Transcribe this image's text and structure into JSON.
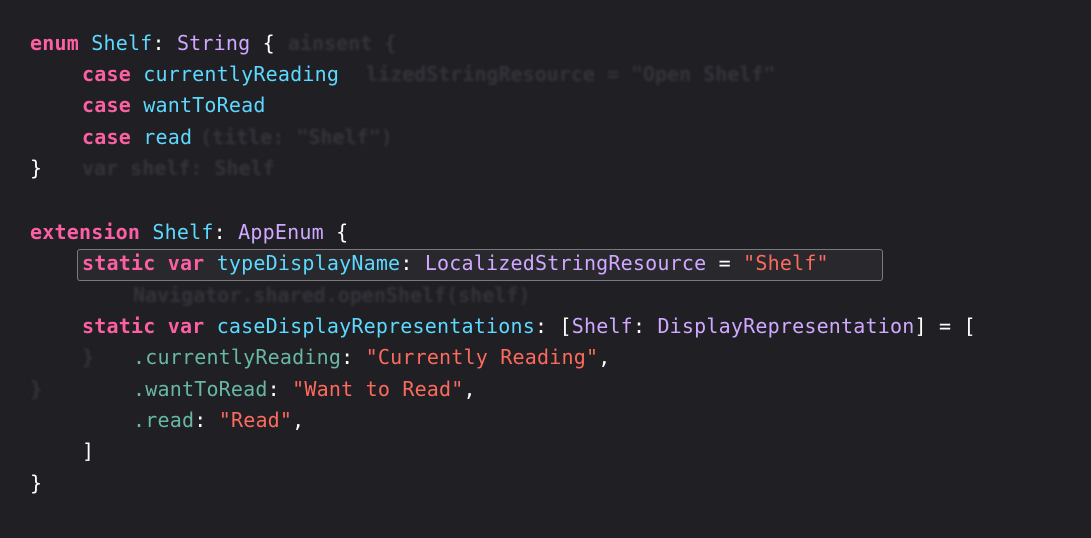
{
  "code": {
    "l1": {
      "kw": "enum",
      "name": "Shelf",
      "colon": ":",
      "type": "String",
      "brace": "{"
    },
    "l2": {
      "kw": "case",
      "name": "currentlyReading"
    },
    "l3": {
      "kw": "case",
      "name": "wantToRead"
    },
    "l4": {
      "kw": "case",
      "name": "read"
    },
    "l5": {
      "brace": "}"
    },
    "l7": {
      "kw": "extension",
      "name": "Shelf",
      "colon": ":",
      "type": "AppEnum",
      "brace": "{"
    },
    "l8": {
      "kw1": "static",
      "kw2": "var",
      "name": "typeDisplayName",
      "colon": ":",
      "type": "LocalizedStringResource",
      "eq": "=",
      "str": "\"Shelf\""
    },
    "l10": {
      "kw1": "static",
      "kw2": "var",
      "name": "caseDisplayRepresentations",
      "colon": ":",
      "open": "[",
      "t1": "Shelf",
      "colon2": ":",
      "t2": "DisplayRepresentation",
      "close": "]",
      "eq": "=",
      "bracket": "["
    },
    "l11": {
      "member": ".currentlyReading",
      "colon": ":",
      "str": "\"Currently Reading\"",
      "comma": ","
    },
    "l12": {
      "member": ".wantToRead",
      "colon": ":",
      "str": "\"Want to Read\"",
      "comma": ","
    },
    "l13": {
      "member": ".read",
      "colon": ":",
      "str": "\"Read\"",
      "comma": ","
    },
    "l14": {
      "bracket": "]"
    },
    "l15": {
      "brace": "}"
    }
  },
  "ghost": {
    "g1": "ainsent {",
    "g2": "lizedStringResource = \"Open Shelf\"",
    "g3": "(title: \"Shelf\")",
    "g4": "var shelf: Shelf",
    "g5": "Navigator.shared.openShelf(shelf)",
    "g6": "}",
    "g7": "}"
  },
  "colors": {
    "background": "#1f1f24",
    "keyword": "#fc5fa3",
    "type": "#d0a8ff",
    "declaration": "#5dd8ff",
    "member": "#67b7a4",
    "string": "#fc6a5d"
  }
}
